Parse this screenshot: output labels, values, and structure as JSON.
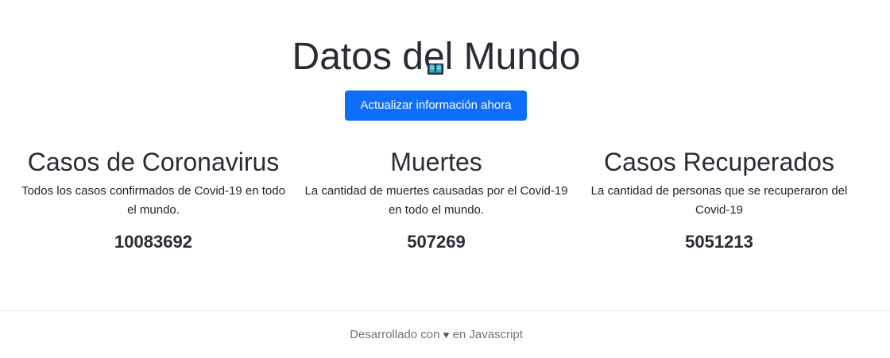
{
  "header": {
    "title": "Datos del Mundo",
    "icon": "open-book-icon",
    "refresh_button_label": "Actualizar información ahora"
  },
  "stats": [
    {
      "title": "Casos de Coronavirus",
      "description": "Todos los casos confirmados de Covid-19 en todo el mundo.",
      "value": "10083692"
    },
    {
      "title": "Muertes",
      "description": "La cantidad de muertes causadas por el Covid-19 en todo el mundo.",
      "value": "507269"
    },
    {
      "title": "Casos Recuperados",
      "description": "La cantidad de personas que se recuperaron del Covid-19",
      "value": "5051213"
    }
  ],
  "footer": {
    "prefix": "Desarrollado con",
    "heart": "♥",
    "suffix": "en Javascript"
  },
  "colors": {
    "accent": "#0d6efd",
    "text": "#2b2b35",
    "muted": "#6c757d"
  }
}
